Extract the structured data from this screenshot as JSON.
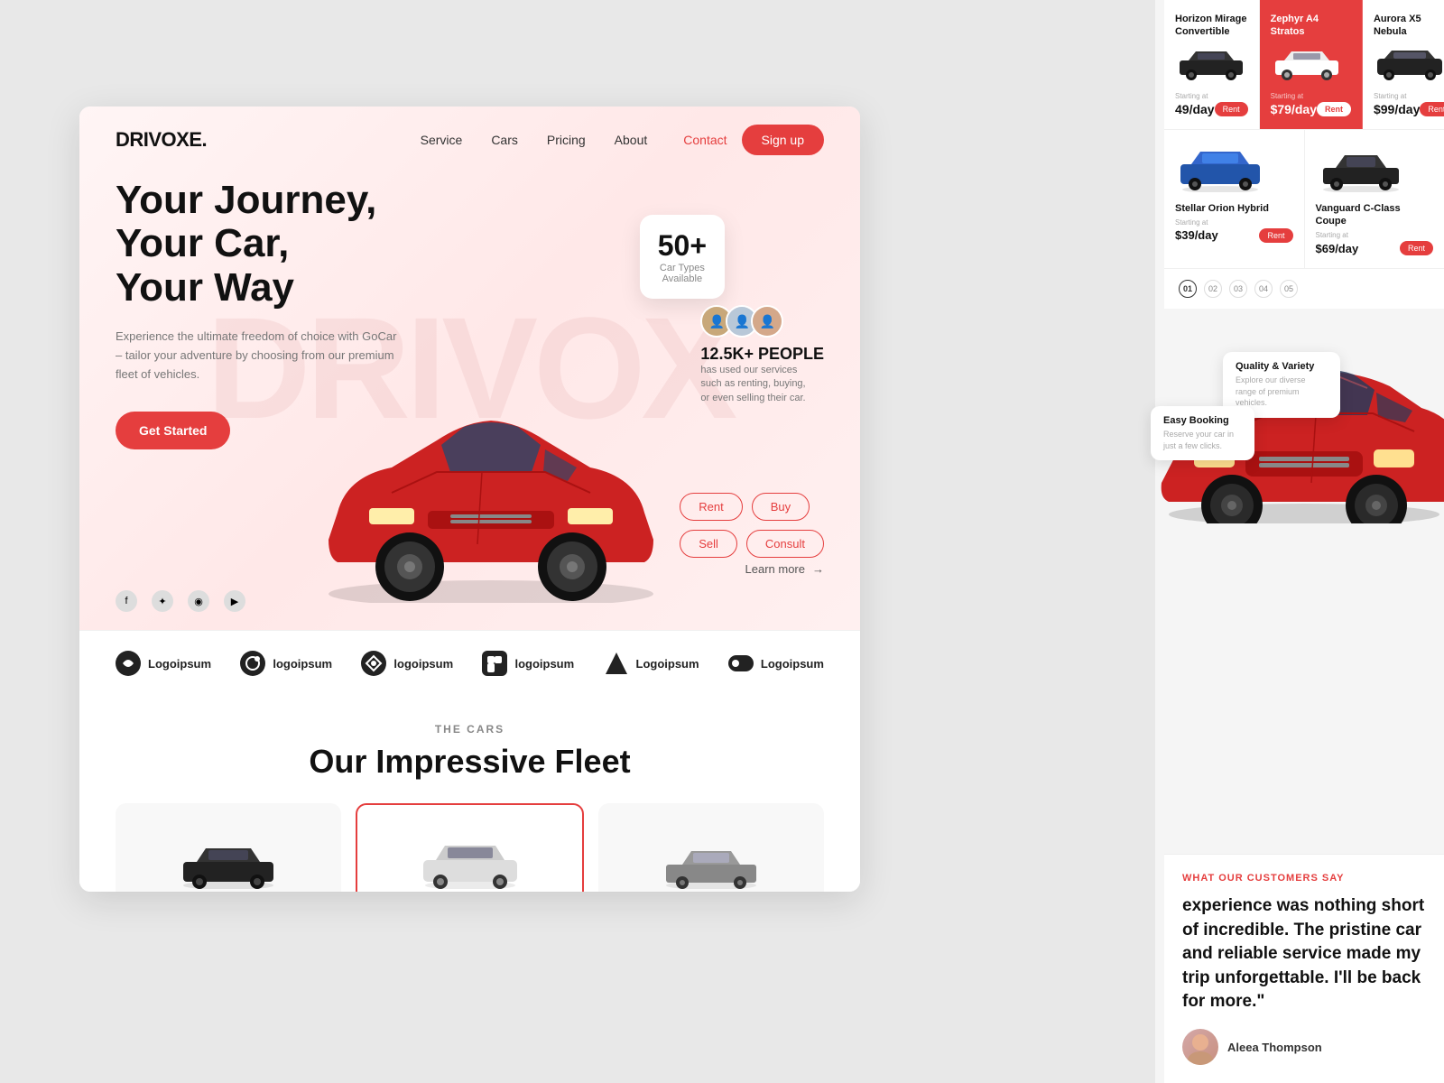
{
  "font_label": "Font",
  "brand": {
    "logo": "DRIVOXE."
  },
  "navbar": {
    "links": [
      "Service",
      "Cars",
      "Pricing",
      "About"
    ],
    "contact": "Contact",
    "signup": "Sign up"
  },
  "hero": {
    "bg_text": "DRIVOX",
    "title_line1": "Your Journey,",
    "title_line2": "Your Car,",
    "title_line3": "Your Way",
    "description": "Experience the ultimate freedom of choice with GoCar – tailor your adventure by choosing from our premium fleet of vehicles.",
    "cta": "Get Started",
    "stats_badge": {
      "number": "50+",
      "label": "Car Types",
      "label2": "Available"
    },
    "people_stats": {
      "count": "12.5K+ PEOPLE",
      "description": "has used our services such as renting, buying, or even selling their car."
    },
    "action_buttons": [
      [
        "Rent",
        "Buy"
      ],
      [
        "Sell",
        "Consult"
      ]
    ],
    "learn_more": "Learn more"
  },
  "partners": [
    {
      "name": "Logoipsum"
    },
    {
      "name": "logoipsum"
    },
    {
      "name": "logoipsum"
    },
    {
      "name": "logoipsum"
    },
    {
      "name": "Logoipsum"
    },
    {
      "name": "Logoipsum"
    }
  ],
  "fleet_section": {
    "subtitle": "THE CARS",
    "title": "Our Impressive Fleet"
  },
  "right_panel": {
    "cars_top": [
      {
        "name": "Horizon Mirage Convertible",
        "starting_at": "Starting at",
        "price": "49/day",
        "rent_btn": "Rent",
        "featured": false
      },
      {
        "name": "Zephyr A4 Stratos",
        "starting_at": "Starting at",
        "price": "$79/day",
        "rent_btn": "Rent",
        "featured": true
      },
      {
        "name": "Aurora X5 Nebula",
        "starting_at": "Starting at",
        "price": "$99/day",
        "rent_btn": "Rent",
        "featured": false
      }
    ],
    "cars_row2": [
      {
        "name": "Stellar Orion Hybrid",
        "starting_at": "Starting at",
        "price": "$39/day",
        "rent_btn": "Rent",
        "featured": false
      },
      {
        "name": "Vanguard C-Class Coupe",
        "starting_at": "Starting at",
        "price": "$69/day",
        "rent_btn": "Rent",
        "featured": false
      }
    ],
    "pagination": [
      "01",
      "02",
      "03",
      "04",
      "05"
    ],
    "quality_badge": {
      "title": "Quality & Variety",
      "text": "Explore our diverse range of premium vehicles."
    },
    "easy_booking": {
      "title": "Easy Booking",
      "text": "Reserve your car in just a few clicks."
    },
    "testimonial": {
      "tag": "WHAT OUR CUSTOMERS SAY",
      "text": "experience was nothing short of incredible. The pristine car and reliable service made my trip unforgettable. I'll be back for more.\"",
      "author": "Aleea Thompson"
    }
  }
}
